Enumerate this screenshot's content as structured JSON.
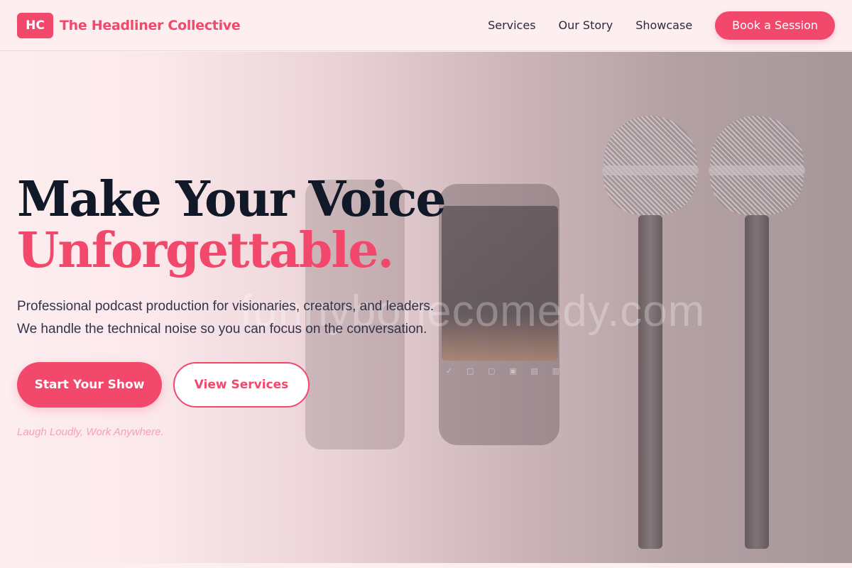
{
  "header": {
    "logo_text": "HC",
    "brand_name": "The Headliner Collective",
    "nav": [
      {
        "label": "Services"
      },
      {
        "label": "Our Story"
      },
      {
        "label": "Showcase"
      }
    ],
    "cta_label": "Book a Session"
  },
  "hero": {
    "headline_line1": "Make Your Voice",
    "headline_line2": "Unforgettable.",
    "subtext_line1": "Professional podcast production for visionaries, creators, and leaders.",
    "subtext_line2": "We handle the technical noise so you can focus on the conversation.",
    "primary_button": "Start Your Show",
    "secondary_button": "View Services",
    "tagline": "Laugh Loudly, Work Anywhere.",
    "watermark": "funnybonecomedy.com"
  },
  "colors": {
    "accent": "#f2486b",
    "background": "#fdeef0",
    "heading": "#111827"
  }
}
